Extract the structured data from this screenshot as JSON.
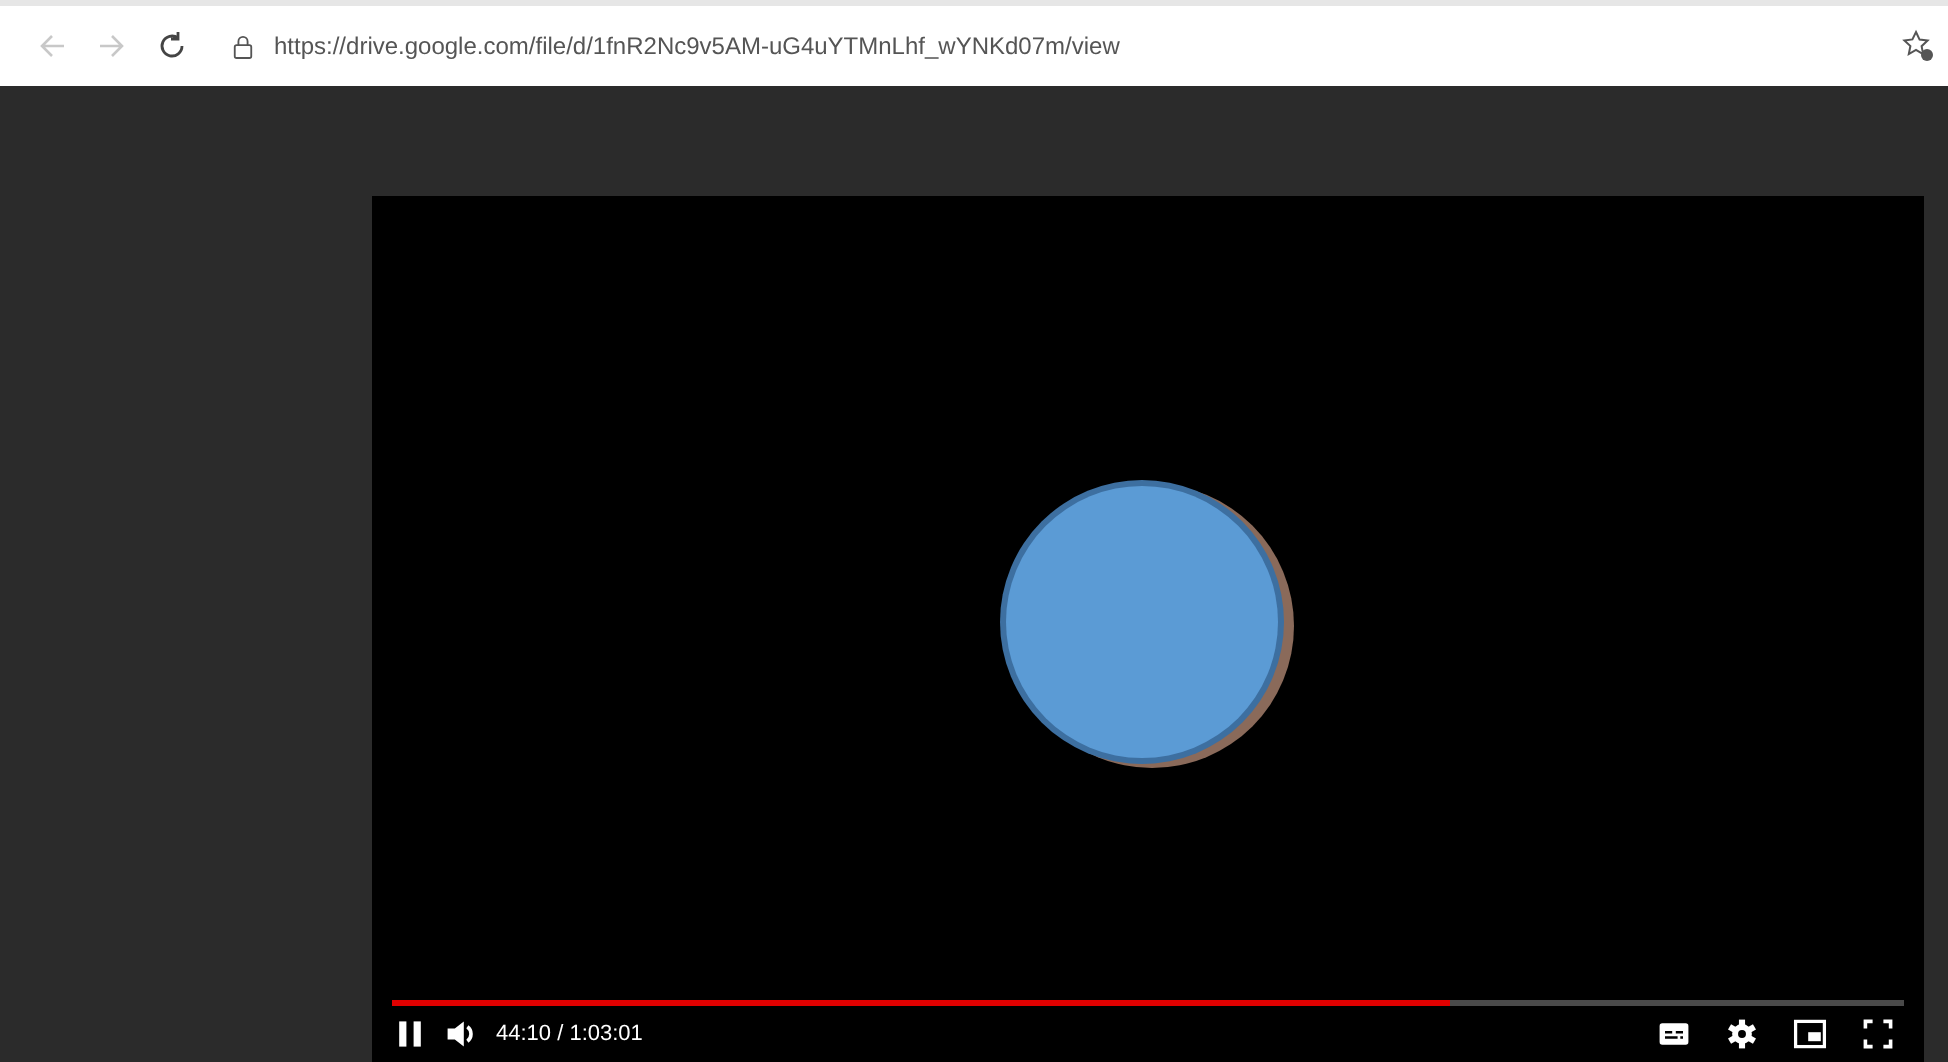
{
  "browser": {
    "url": "https://drive.google.com/file/d/1fnR2Nc9v5AM-uG4uYTMnLhf_wYNKd07m/view"
  },
  "player": {
    "progress": {
      "level": 0.7
    },
    "playing": true,
    "time": "44:10 / 1:03:01"
  }
}
